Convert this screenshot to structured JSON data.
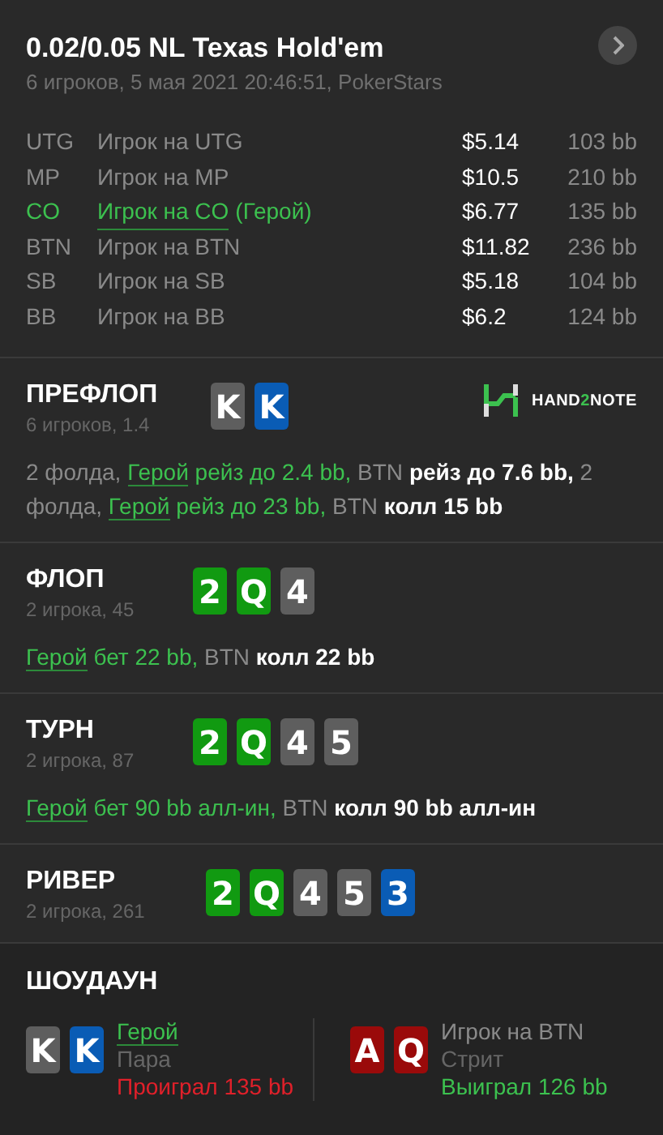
{
  "header": {
    "title": "0.02/0.05 NL Texas Hold'em",
    "subtitle": "6 игроков, 5 мая 2021 20:46:51, PokerStars"
  },
  "seats": [
    {
      "position": "UTG",
      "player": "Игрок на UTG",
      "stack": "$5.14",
      "bb": "103 bb",
      "hero": false
    },
    {
      "position": "MP",
      "player": "Игрок на MP",
      "stack": "$10.5",
      "bb": "210 bb",
      "hero": false
    },
    {
      "position": "CO",
      "player": "Игрок на CO",
      "hero_tag": "(Герой)",
      "stack": "$6.77",
      "bb": "135 bb",
      "hero": true
    },
    {
      "position": "BTN",
      "player": "Игрок на BTN",
      "stack": "$11.82",
      "bb": "236 bb",
      "hero": false
    },
    {
      "position": "SB",
      "player": "Игрок на SB",
      "stack": "$5.18",
      "bb": "104 bb",
      "hero": false
    },
    {
      "position": "BB",
      "player": "Игрок на BB",
      "stack": "$6.2",
      "bb": "124 bb",
      "hero": false
    }
  ],
  "logo": {
    "before": "HAND",
    "accent": "2",
    "after": "NOTE"
  },
  "streets": [
    {
      "name": "ПРЕФЛОП",
      "info": "6 игроков, 1.4",
      "logo": true,
      "cards": [
        {
          "rank": "K",
          "color": "#5e5e5e"
        },
        {
          "rank": "K",
          "color": "#0a5cb5"
        }
      ],
      "actions": [
        {
          "kind": "muted",
          "text": "2 фолда, "
        },
        {
          "kind": "hero",
          "text": "Герой"
        },
        {
          "kind": "hero_action",
          "text": " рейз до 2.4 bb, "
        },
        {
          "kind": "muted",
          "text": "BTN "
        },
        {
          "kind": "action",
          "text": "рейз до 7.6 bb, "
        },
        {
          "kind": "muted",
          "text": "2 фолда, "
        },
        {
          "kind": "hero",
          "text": "Герой"
        },
        {
          "kind": "hero_action",
          "text": " рейз до 23 bb, "
        },
        {
          "kind": "muted",
          "text": "BTN "
        },
        {
          "kind": "action",
          "text": "колл 15 bb"
        }
      ]
    },
    {
      "name": "ФЛОП",
      "info": "2 игрока, 45",
      "logo": false,
      "cards": [
        {
          "rank": "2",
          "color": "#119a11"
        },
        {
          "rank": "Q",
          "color": "#119a11"
        },
        {
          "rank": "4",
          "color": "#5e5e5e"
        }
      ],
      "actions": [
        {
          "kind": "hero",
          "text": "Герой"
        },
        {
          "kind": "hero_action",
          "text": " бет 22 bb, "
        },
        {
          "kind": "muted",
          "text": "BTN "
        },
        {
          "kind": "action",
          "text": "колл 22 bb"
        }
      ]
    },
    {
      "name": "ТУРН",
      "info": "2 игрока, 87",
      "logo": false,
      "cards": [
        {
          "rank": "2",
          "color": "#119a11"
        },
        {
          "rank": "Q",
          "color": "#119a11"
        },
        {
          "rank": "4",
          "color": "#5e5e5e"
        },
        {
          "rank": "5",
          "color": "#5e5e5e"
        }
      ],
      "actions": [
        {
          "kind": "hero",
          "text": "Герой"
        },
        {
          "kind": "hero_action",
          "text": " бет 90 bb алл-ин, "
        },
        {
          "kind": "muted",
          "text": "BTN "
        },
        {
          "kind": "action",
          "text": "колл 90 bb алл-ин"
        }
      ]
    },
    {
      "name": "РИВЕР",
      "info": "2 игрока, 261",
      "logo": false,
      "cards": [
        {
          "rank": "2",
          "color": "#119a11"
        },
        {
          "rank": "Q",
          "color": "#119a11"
        },
        {
          "rank": "4",
          "color": "#5e5e5e"
        },
        {
          "rank": "5",
          "color": "#5e5e5e"
        },
        {
          "rank": "3",
          "color": "#0a5cb5"
        }
      ]
    }
  ],
  "showdown": {
    "title": "ШОУДАУН",
    "players": [
      {
        "name": "Герой",
        "hero": true,
        "hand": "Пара",
        "result": "Проиграл 135 bb",
        "won": false,
        "cards": [
          {
            "rank": "K",
            "color": "#5e5e5e"
          },
          {
            "rank": "K",
            "color": "#0a5cb5"
          }
        ]
      },
      {
        "name": "Игрок на BTN",
        "hero": false,
        "hand": "Стрит",
        "result": "Выиграл 126 bb",
        "won": true,
        "cards": [
          {
            "rank": "A",
            "color": "#9a0a0a"
          },
          {
            "rank": "Q",
            "color": "#9a0a0a"
          }
        ]
      }
    ]
  }
}
